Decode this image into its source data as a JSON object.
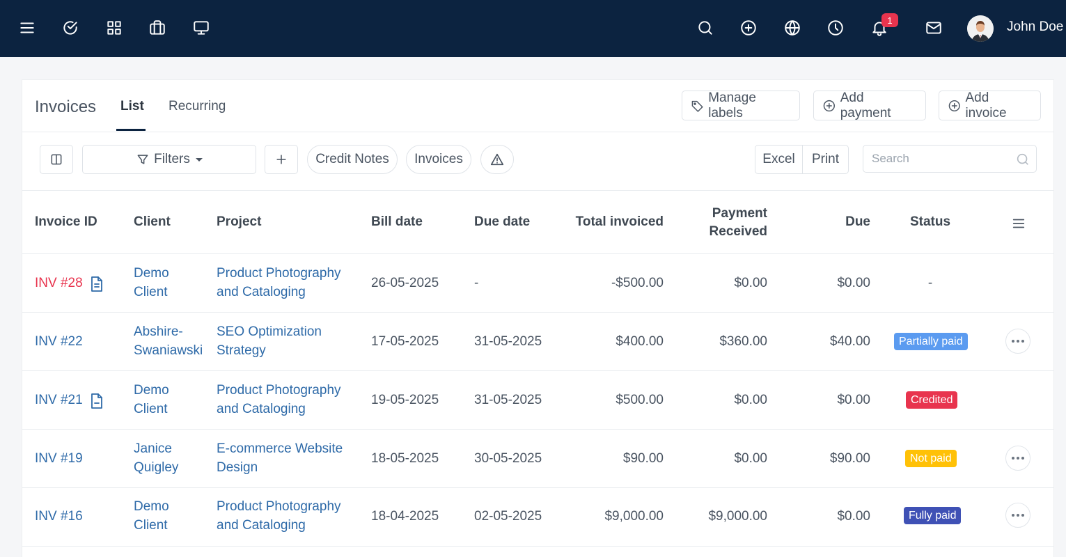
{
  "topbar": {
    "user_name": "John Doe",
    "notification_count": "1",
    "icons": [
      "menu-icon",
      "check-circle-icon",
      "grid-icon",
      "briefcase-icon",
      "monitor-icon",
      "search-icon",
      "plus-circle-icon",
      "globe-icon",
      "clock-icon",
      "bell-icon",
      "mail-icon"
    ]
  },
  "header": {
    "title": "Invoices",
    "tabs": [
      {
        "label": "List",
        "active": true
      },
      {
        "label": "Recurring",
        "active": false
      }
    ],
    "buttons": {
      "manage_labels": "Manage labels",
      "add_payment": "Add payment",
      "add_invoice": "Add invoice"
    }
  },
  "toolbar": {
    "filters_label": "Filters",
    "credit_notes_label": "Credit Notes",
    "invoices_label": "Invoices",
    "excel_label": "Excel",
    "print_label": "Print",
    "search_placeholder": "Search"
  },
  "table": {
    "columns": {
      "invoice_id": "Invoice ID",
      "client": "Client",
      "project": "Project",
      "bill_date": "Bill date",
      "due_date": "Due date",
      "total_invoiced": "Total invoiced",
      "payment_received_1": "Payment",
      "payment_received_2": "Received",
      "due": "Due",
      "status": "Status"
    },
    "rows": [
      {
        "id": "INV #28",
        "client_1": "Demo",
        "client_2": "Client",
        "project_1": "Product Photography",
        "project_2": "and Cataloging",
        "bill_date": "26-05-2025",
        "due_date": "-",
        "total": "-$500.00",
        "received": "$0.00",
        "due": "$0.00",
        "status": "-"
      },
      {
        "id": "INV #22",
        "client_1": "Abshire-",
        "client_2": "Swaniawski",
        "project_1": "SEO Optimization",
        "project_2": "Strategy",
        "bill_date": "17-05-2025",
        "due_date": "31-05-2025",
        "total": "$400.00",
        "received": "$360.00",
        "due": "$40.00",
        "status": "Partially paid"
      },
      {
        "id": "INV #21",
        "client_1": "Demo",
        "client_2": "Client",
        "project_1": "Product Photography",
        "project_2": "and Cataloging",
        "bill_date": "19-05-2025",
        "due_date": "31-05-2025",
        "total": "$500.00",
        "received": "$0.00",
        "due": "$0.00",
        "status": "Credited"
      },
      {
        "id": "INV #19",
        "client_1": "Janice",
        "client_2": "Quigley",
        "project_1": "E-commerce Website",
        "project_2": "Design",
        "bill_date": "18-05-2025",
        "due_date": "30-05-2025",
        "total": "$90.00",
        "received": "$0.00",
        "due": "$90.00",
        "status": "Not paid"
      },
      {
        "id": "INV #16",
        "client_1": "Demo",
        "client_2": "Client",
        "project_1": "Product Photography",
        "project_2": "and Cataloging",
        "bill_date": "18-04-2025",
        "due_date": "02-05-2025",
        "total": "$9,000.00",
        "received": "$9,000.00",
        "due": "$0.00",
        "status": "Fully paid"
      }
    ]
  },
  "colors": {
    "topbar": "#0c2340",
    "link": "#2e6aa8",
    "red": "#e8344e",
    "partially_paid": "#5b9bf0",
    "credited": "#e8344e",
    "not_paid": "#ffc107",
    "fully_paid": "#3f51b5"
  }
}
